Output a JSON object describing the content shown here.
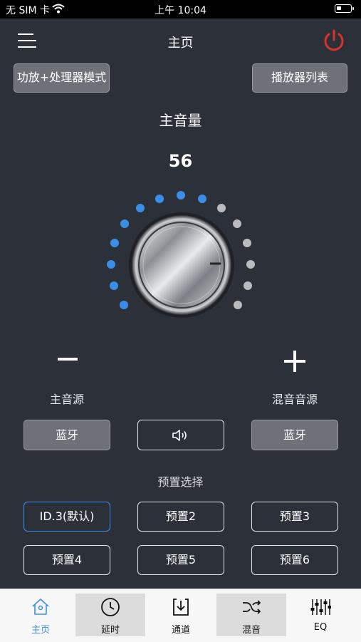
{
  "status_bar": {
    "carrier": "无 SIM 卡",
    "time": "上午 10:04"
  },
  "header": {
    "title": "主页"
  },
  "buttons": {
    "mode": "功放+处理器模式",
    "player_list": "播放器列表"
  },
  "volume": {
    "title": "主音量",
    "value": "56",
    "level_fraction": 0.56
  },
  "sources": {
    "main_label": "主音源",
    "mix_label": "混音音源",
    "main_value": "蓝牙",
    "mix_value": "蓝牙"
  },
  "presets": {
    "title": "预置选择",
    "items": [
      "ID.3(默认)",
      "预置2",
      "预置3",
      "预置4",
      "预置5",
      "预置6"
    ],
    "selected_index": 0
  },
  "tabs": [
    {
      "label": "主页",
      "icon": "home-icon"
    },
    {
      "label": "延时",
      "icon": "clock-icon"
    },
    {
      "label": "通道",
      "icon": "channel-icon"
    },
    {
      "label": "混音",
      "icon": "shuffle-icon"
    },
    {
      "label": "EQ",
      "icon": "equalizer-icon"
    }
  ],
  "colors": {
    "background": "#2c3039",
    "accent": "#3b8ee8",
    "power": "#d9342b",
    "dot_inactive": "#b9bbbf"
  }
}
